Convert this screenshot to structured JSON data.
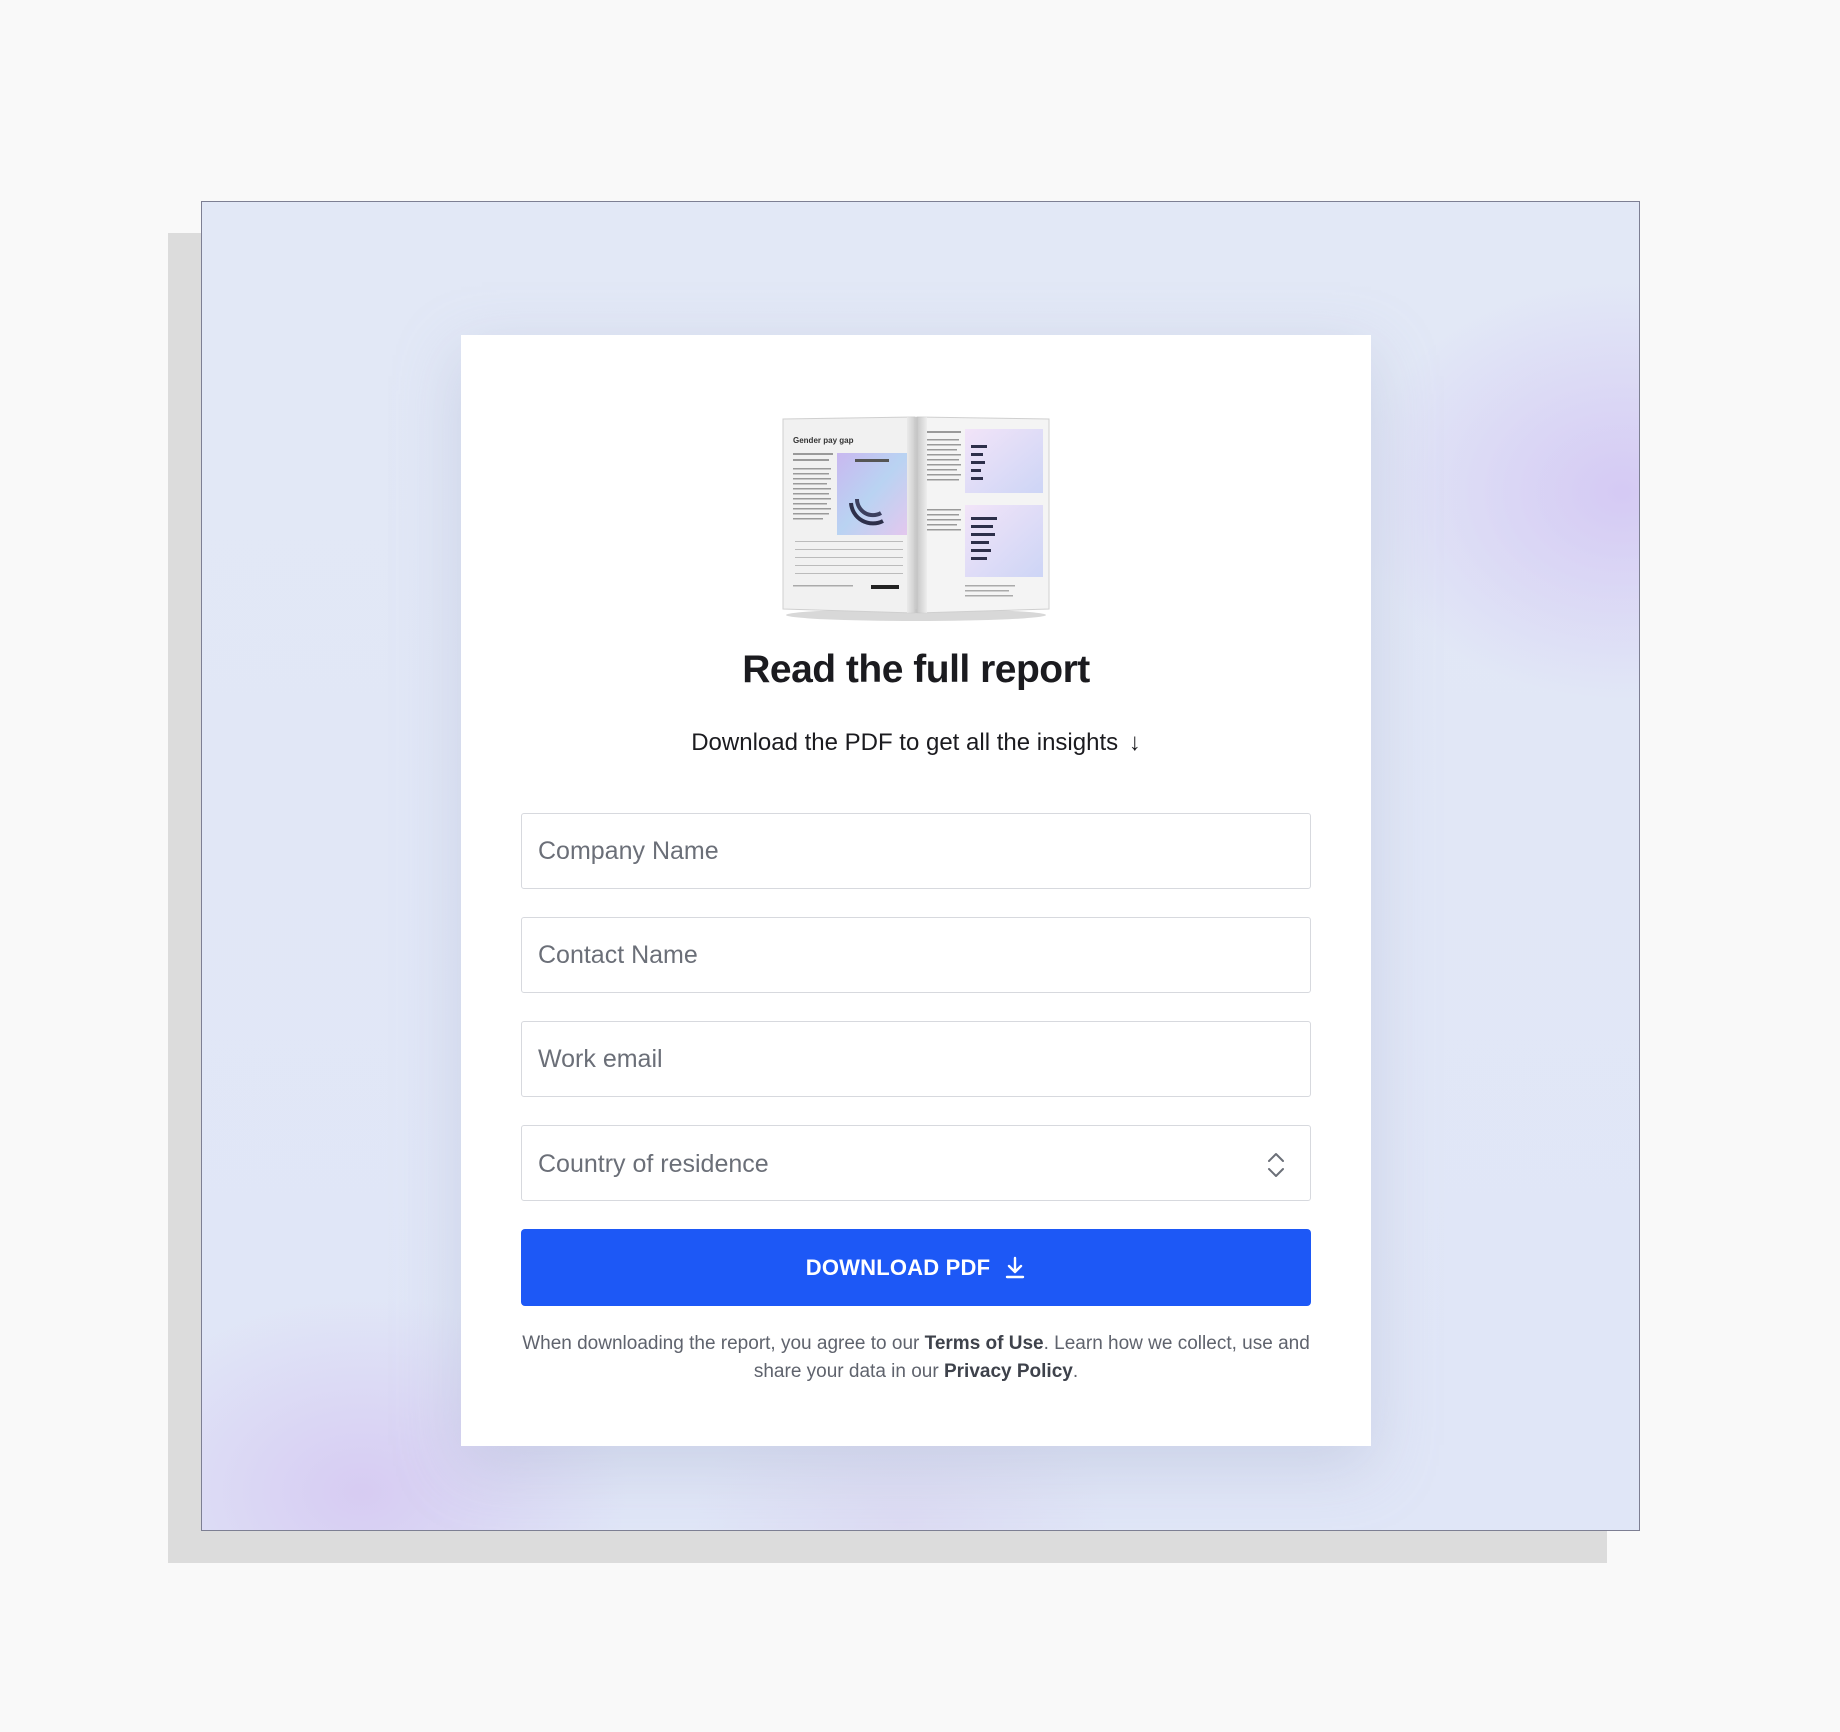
{
  "hero": {
    "title": "Read the full report",
    "subtitle": "Download the PDF to get all the insights",
    "subtitle_arrow": "↓"
  },
  "report_preview": {
    "heading": "Gender pay gap"
  },
  "form": {
    "company_placeholder": "Company Name",
    "contact_placeholder": "Contact Name",
    "email_placeholder": "Work email",
    "country_value": "Country of residence",
    "submit_label": "DOWNLOAD PDF"
  },
  "legal": {
    "text_1": "When downloading the report, you agree to our",
    "terms_link": "Terms of Use",
    "text_2": ". Learn how we collect, use and share your data in our",
    "privacy_link": "Privacy Policy",
    "text_3": "."
  },
  "colors": {
    "accent": "#1d58f6",
    "page_background": "#f9f9f9",
    "frame_background": "#e2e8f6"
  }
}
